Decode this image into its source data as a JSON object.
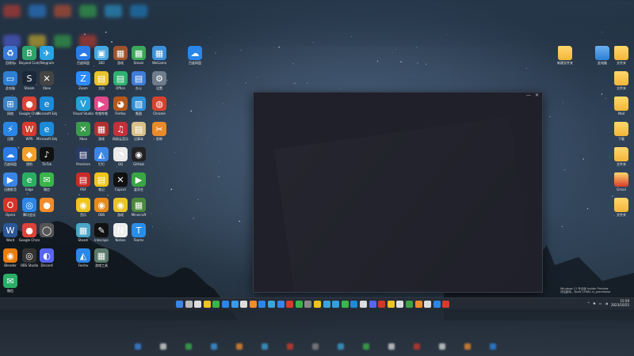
{
  "desktop": {
    "left_icons": [
      {
        "label": "回收站",
        "color": "#3a7bd5",
        "glyph": "♻"
      },
      {
        "label": "Beyond Compare",
        "color": "#2fa36b",
        "glyph": "B"
      },
      {
        "label": "Telegram",
        "color": "#2aa3e0",
        "glyph": "✈"
      },
      {
        "label": "此电脑",
        "color": "#2d7fd3",
        "glyph": "▭"
      },
      {
        "label": "Steam",
        "color": "#1b2838",
        "glyph": "S"
      },
      {
        "label": "Xbox",
        "color": "#444",
        "glyph": "✕"
      },
      {
        "label": "网络",
        "color": "#3b82c4",
        "glyph": "⊞"
      },
      {
        "label": "Google Chrome",
        "color": "#dc4437",
        "glyph": "●"
      },
      {
        "label": "Microsoft Edge",
        "color": "#1c8ad6",
        "glyph": "e"
      },
      {
        "label": "迅雷",
        "color": "#2a86e6",
        "glyph": "⚡"
      },
      {
        "label": "WPS",
        "color": "#d83b2c",
        "glyph": "W"
      },
      {
        "label": "Microsoft Edge",
        "color": "#1c8ad6",
        "glyph": "e"
      },
      {
        "label": "百度网盘",
        "color": "#2b7ce9",
        "glyph": "☁"
      },
      {
        "label": "猎豹",
        "color": "#f0a028",
        "glyph": "◆"
      },
      {
        "label": "TikTok",
        "color": "#111",
        "glyph": "♪"
      },
      {
        "label": "迅雷影音",
        "color": "#3a86e6",
        "glyph": "▶"
      },
      {
        "label": "Edge",
        "color": "#2cae62",
        "glyph": "e"
      },
      {
        "label": "微信",
        "color": "#39b54a",
        "glyph": "✉"
      },
      {
        "label": "Opera",
        "color": "#d4352a",
        "glyph": "O"
      },
      {
        "label": "腾讯会议",
        "color": "#2b86e8",
        "glyph": "◎"
      },
      {
        "label": "",
        "color": "#f08c2c",
        "glyph": "●"
      },
      {
        "label": "Word",
        "color": "#2b5797",
        "glyph": "W"
      },
      {
        "label": "Google Chrome",
        "color": "#dc4437",
        "glyph": "●"
      },
      {
        "label": "",
        "color": "#555",
        "glyph": "◯"
      },
      {
        "label": "Blender",
        "color": "#e87d0d",
        "glyph": "◉"
      },
      {
        "label": "OBS Studio",
        "color": "#333",
        "glyph": "◎"
      },
      {
        "label": "Discord",
        "color": "#5865f2",
        "glyph": "◐"
      },
      {
        "label": "微信",
        "color": "#2aae67",
        "glyph": "✉"
      }
    ],
    "mid_icons": [
      {
        "label": "百度网盘",
        "color": "#2a7be8",
        "glyph": "☁"
      },
      {
        "label": "360",
        "color": "#48a8e0",
        "glyph": "▣"
      },
      {
        "label": "游戏",
        "color": "#a0522d",
        "glyph": "▦"
      },
      {
        "label": "Steam",
        "color": "#3aa85a",
        "glyph": "▦"
      },
      {
        "label": "WeGame",
        "color": "#3d8fd8",
        "glyph": "▦"
      },
      {
        "label": "Zoom",
        "color": "#2d8cff",
        "glyph": "Z"
      },
      {
        "label": "文档",
        "color": "#e8c32a",
        "glyph": "▤"
      },
      {
        "label": "Office",
        "color": "#2eb170",
        "glyph": "▤"
      },
      {
        "label": "办公",
        "color": "#3e7dd8",
        "glyph": "▤"
      },
      {
        "label": "设置",
        "color": "#6e7c8c",
        "glyph": "⚙"
      },
      {
        "label": "Visual Studio",
        "color": "#27a0d8",
        "glyph": "V"
      },
      {
        "label": "哔哩哔哩",
        "color": "#e44a8b",
        "glyph": "▶"
      },
      {
        "label": "Firefox",
        "color": "#b5571c",
        "glyph": "◕"
      },
      {
        "label": "画图",
        "color": "#2f8fd6",
        "glyph": "▨"
      },
      {
        "label": "Chrome",
        "color": "#d2442e",
        "glyph": "◍"
      },
      {
        "label": "Xbox",
        "color": "#3a9b4d",
        "glyph": "✕"
      },
      {
        "label": "游戏",
        "color": "#b03030",
        "glyph": "▦"
      },
      {
        "label": "网易云音乐",
        "color": "#c2303a",
        "glyph": "♫"
      },
      {
        "label": "记事本",
        "color": "#d8c08a",
        "glyph": "▤"
      },
      {
        "label": "剪映",
        "color": "#e8892a",
        "glyph": "✂"
      },
      {
        "label": "Premiere",
        "color": "#2a3a66",
        "glyph": "▤"
      },
      {
        "label": "钉钉",
        "color": "#3a86e8",
        "glyph": "◭"
      },
      {
        "label": "QQ",
        "color": "#eaeaea",
        "glyph": "◔"
      },
      {
        "label": "GitHub",
        "color": "#222",
        "glyph": "◉"
      },
      {
        "label": "PDF",
        "color": "#c72a2a",
        "glyph": "▤"
      },
      {
        "label": "笔记",
        "color": "#f0c419",
        "glyph": "▤"
      },
      {
        "label": "Capcut",
        "color": "#111",
        "glyph": "✕"
      },
      {
        "label": "爱奇艺",
        "color": "#3aa545",
        "glyph": "▶"
      },
      {
        "label": "音乐",
        "color": "#f0c419",
        "glyph": "◉"
      },
      {
        "label": "OBS",
        "color": "#e88a1a",
        "glyph": "◉"
      },
      {
        "label": "游戏",
        "color": "#e8c32a",
        "glyph": "◉"
      },
      {
        "label": "Minecraft",
        "color": "#4a8a3a",
        "glyph": "▦"
      },
      {
        "label": "Steam",
        "color": "#4aa5c8",
        "glyph": "▦"
      },
      {
        "label": "Inkscape",
        "color": "#111",
        "glyph": "✎"
      },
      {
        "label": "Notion",
        "color": "#eee",
        "glyph": "N"
      },
      {
        "label": "Teams",
        "color": "#2a8ee6",
        "glyph": "T"
      },
      {
        "label": "Feishu",
        "color": "#2a86e8",
        "glyph": "◭"
      },
      {
        "label": "游戏工具",
        "color": "#5a7a6a",
        "glyph": "▦"
      }
    ],
    "right_icons": [
      {
        "label": "新建文件夹",
        "type": "folder"
      },
      {
        "label": "此电脑",
        "type": "pc"
      },
      {
        "label": "文件夹",
        "type": "folder"
      },
      {
        "label": "文件夹",
        "type": "folder"
      },
      {
        "label": "Mail",
        "type": "folder"
      },
      {
        "label": "下载",
        "type": "folder"
      },
      {
        "label": "文件夹",
        "type": "folder"
      },
      {
        "label": "Gmail",
        "type": "mail"
      },
      {
        "label": "文件夹",
        "type": "folder"
      }
    ],
    "floating_icon": {
      "label": "百度网盘",
      "color": "#2a86e8",
      "glyph": "☁"
    }
  },
  "window": {
    "controls": [
      "—",
      "✕"
    ]
  },
  "taskbar": {
    "icons": [
      "#3a86e8",
      "#bbb",
      "#ddd",
      "#f0c419",
      "#39b54a",
      "#2a86e8",
      "#3a9be8",
      "#ddd",
      "#f08c2c",
      "#2a86e8",
      "#3aa5d8",
      "#3a86e8",
      "#d83b2c",
      "#39b54a",
      "#888",
      "#f0c419",
      "#3aa5d8",
      "#2aa3e0",
      "#39b54a",
      "#1c8ad6",
      "#ddd",
      "#5865f2",
      "#d4352a",
      "#f0c419",
      "#ddd",
      "#3aa545",
      "#f08c2c",
      "#ddd",
      "#2a86e8",
      "#d83b2c"
    ],
    "tray": [
      "^",
      "✱",
      "▭",
      "◑"
    ],
    "time": "15:59",
    "date": "2023/10/25"
  },
  "watermark": {
    "line1": "Windows 11 专业版 Insider Preview",
    "line2": "评估副本。Build 25982.rs_prerelease"
  }
}
